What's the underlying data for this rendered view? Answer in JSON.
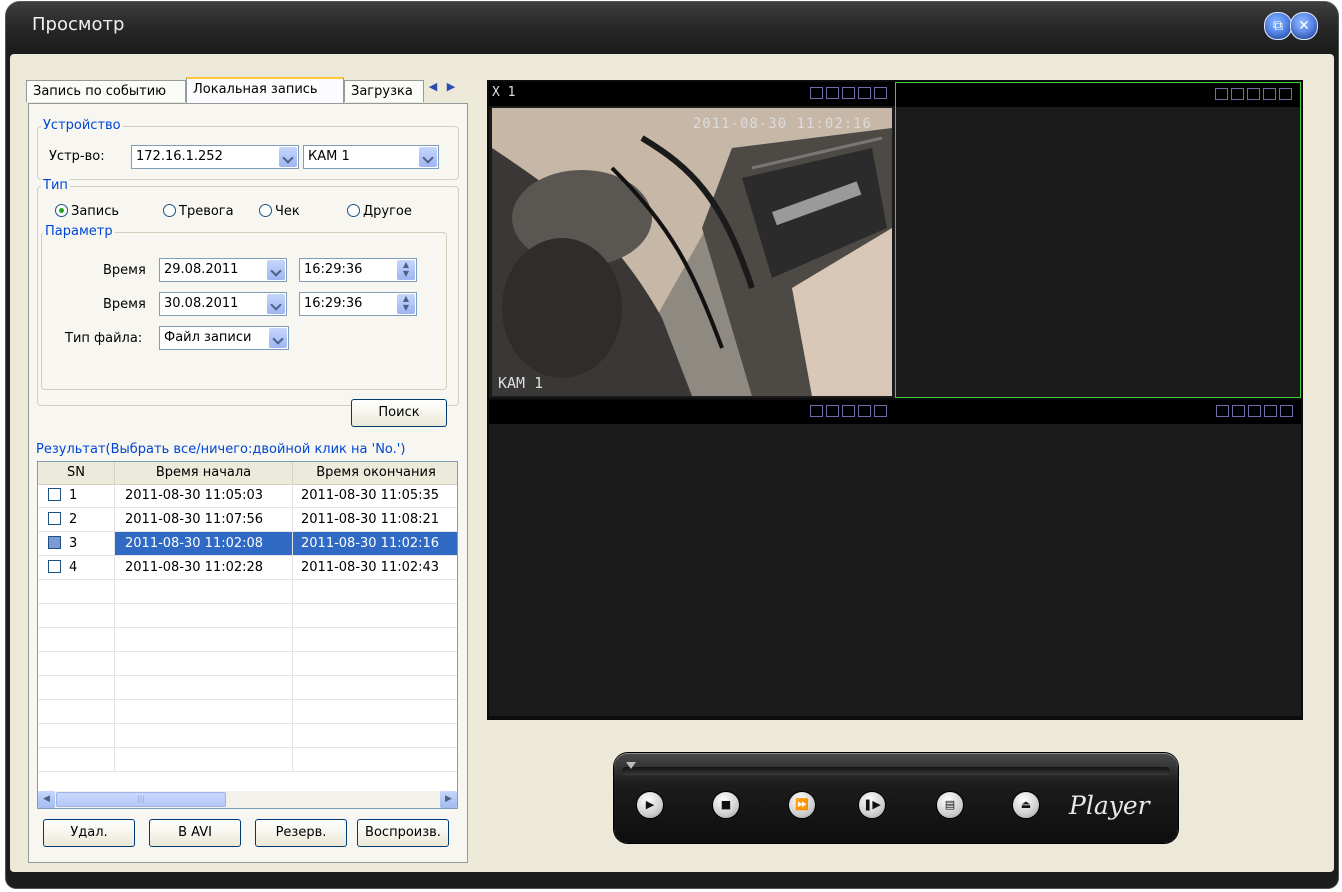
{
  "window": {
    "title": "Просмотр"
  },
  "tabs": [
    {
      "label": "Запись по событию",
      "active": false
    },
    {
      "label": "Локальная запись",
      "active": true
    },
    {
      "label": "Загрузка",
      "active": false
    }
  ],
  "device_group": {
    "label": "Устройство",
    "device_label": "Устр-во:",
    "device_value": "172.16.1.252",
    "camera_value": "КАМ 1"
  },
  "type_group": {
    "label": "Тип",
    "options": [
      "Запись",
      "Тревога",
      "Чек",
      "Другое"
    ],
    "selected": "Запись"
  },
  "param_group": {
    "label": "Параметр",
    "start_label": "Время",
    "start_date": "29.08.2011",
    "start_time": "16:29:36",
    "end_label": "Время",
    "end_date": "30.08.2011",
    "end_time": "16:29:36",
    "filetype_label": "Тип файла:",
    "filetype_value": "Файл записи"
  },
  "search_button": "Поиск",
  "results": {
    "label": "Результат(Выбрать все/ничего:двойной клик на 'No.')",
    "columns": [
      "SN",
      "Время начала",
      "Время окончания"
    ],
    "rows": [
      {
        "sn": "1",
        "start": "2011-08-30 11:05:03",
        "end": "2011-08-30 11:05:35",
        "selected": false
      },
      {
        "sn": "2",
        "start": "2011-08-30 11:07:56",
        "end": "2011-08-30 11:08:21",
        "selected": false
      },
      {
        "sn": "3",
        "start": "2011-08-30 11:02:08",
        "end": "2011-08-30 11:02:16",
        "selected": true
      },
      {
        "sn": "4",
        "start": "2011-08-30 11:02:28",
        "end": "2011-08-30 11:02:43",
        "selected": false
      }
    ]
  },
  "actions": [
    "Удал.",
    "В AVI",
    "Резерв.",
    "Воспроизв."
  ],
  "video": {
    "channel_label": "X 1",
    "osd_time": "2011-08-30 11:02:16",
    "osd_camera": "КАМ 1"
  },
  "player": {
    "logo": "Player"
  },
  "colors": {
    "selection": "#316ac5",
    "focus_border": "#3fcf3f",
    "group_label": "#0046d5"
  }
}
